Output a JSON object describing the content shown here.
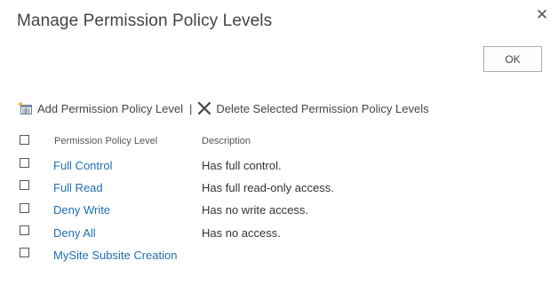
{
  "dialog": {
    "title": "Manage Permission Policy Levels",
    "close_glyph": "✕",
    "ok_label": "OK"
  },
  "toolbar": {
    "add_label": "Add Permission Policy Level",
    "separator": "|",
    "delete_label": "Delete Selected Permission Policy Levels"
  },
  "table": {
    "headers": {
      "name": "Permission Policy Level",
      "description": "Description"
    },
    "rows": [
      {
        "name": "Full Control",
        "description": "Has full control."
      },
      {
        "name": "Full Read",
        "description": "Has full read-only access."
      },
      {
        "name": "Deny Write",
        "description": "Has no write access."
      },
      {
        "name": "Deny All",
        "description": "Has no access."
      },
      {
        "name": "MySite Subsite Creation",
        "description": ""
      }
    ]
  },
  "colors": {
    "link": "#1f6fb5",
    "text": "#444444"
  },
  "icons": {
    "add": "add-list-icon",
    "delete": "delete-x-icon",
    "close": "close-icon"
  }
}
